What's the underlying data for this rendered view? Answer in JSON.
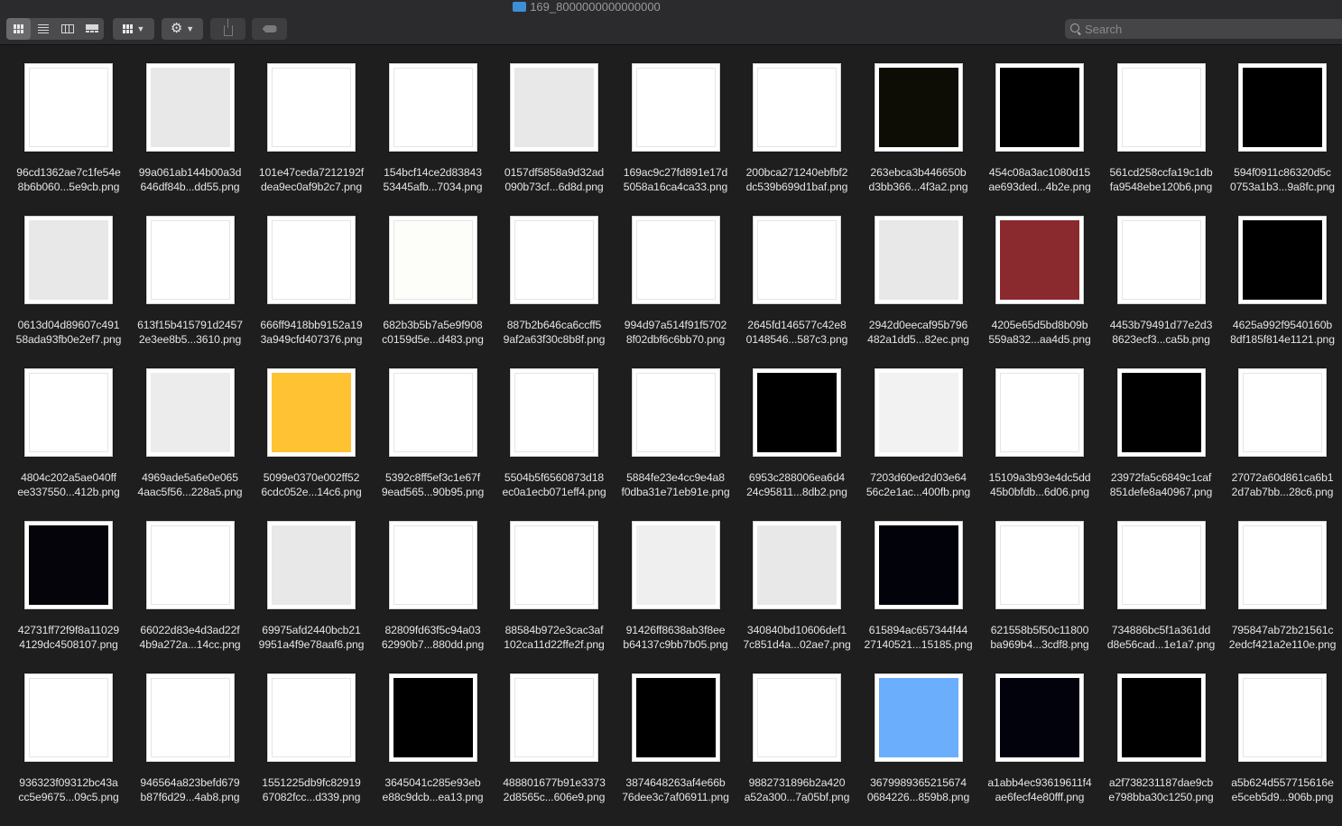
{
  "window": {
    "title": "169_8000000000000000"
  },
  "toolbar": {
    "views": [
      "icon-view",
      "list-view",
      "column-view",
      "gallery-view"
    ],
    "group_icon": "group-by-icon",
    "action_icon": "gear-icon",
    "share_icon": "share-icon",
    "tag_icon": "tag-icon"
  },
  "search": {
    "placeholder": "Search",
    "value": ""
  },
  "files": [
    {
      "line1": "96cd1362ae7c1fe54e",
      "line2": "8b6b060...5e9cb.png",
      "color": "#ffffff"
    },
    {
      "line1": "99a061ab144b00a3d",
      "line2": "646df84b...dd55.png",
      "color": "#e8e8e8"
    },
    {
      "line1": "101e47ceda7212192f",
      "line2": "dea9ec0af9b2c7.png",
      "color": "#ffffff"
    },
    {
      "line1": "154bcf14ce2d83843",
      "line2": "53445afb...7034.png",
      "color": "#ffffff"
    },
    {
      "line1": "0157df5858a9d32ad",
      "line2": "090b73cf...6d8d.png",
      "color": "#e8e8e8"
    },
    {
      "line1": "169ac9c27fd891e17d",
      "line2": "5058a16ca4ca33.png",
      "color": "#ffffff"
    },
    {
      "line1": "200bca271240ebfbf2",
      "line2": "dc539b699d1baf.png",
      "color": "#ffffff"
    },
    {
      "line1": "263ebca3b446650b",
      "line2": "d3bb366...4f3a2.png",
      "color": "#0d0c05"
    },
    {
      "line1": "454c08a3ac1080d15",
      "line2": "ae693ded...4b2e.png",
      "color": "#000000"
    },
    {
      "line1": "561cd258ccfa19c1db",
      "line2": "fa9548ebe120b6.png",
      "color": "#ffffff"
    },
    {
      "line1": "594f0911c86320d5c",
      "line2": "0753a1b3...9a8fc.png",
      "color": "#000000"
    },
    {
      "line1": "0613d04d89607c491",
      "line2": "58ada93fb0e2ef7.png",
      "color": "#e8e8e8"
    },
    {
      "line1": "613f15b415791d2457",
      "line2": "2e3ee8b5...3610.png",
      "color": "#ffffff"
    },
    {
      "line1": "666ff9418bb9152a19",
      "line2": "3a949cfd407376.png",
      "color": "#ffffff"
    },
    {
      "line1": "682b3b5b7a5e9f908",
      "line2": "c0159d5e...d483.png",
      "color": "#fdfdf9"
    },
    {
      "line1": "887b2b646ca6ccff5",
      "line2": "9af2a63f30c8b8f.png",
      "color": "#ffffff"
    },
    {
      "line1": "994d97a514f91f5702",
      "line2": "8f02dbf6c6bb70.png",
      "color": "#ffffff"
    },
    {
      "line1": "2645fd146577c42e8",
      "line2": "0148546...587c3.png",
      "color": "#ffffff"
    },
    {
      "line1": "2942d0eecaf95b796",
      "line2": "482a1dd5...82ec.png",
      "color": "#e8e8e8"
    },
    {
      "line1": "4205e65d5bd8b09b",
      "line2": "559a832...aa4d5.png",
      "color": "#8b2a2e"
    },
    {
      "line1": "4453b79491d77e2d3",
      "line2": "8623ecf3...ca5b.png",
      "color": "#ffffff"
    },
    {
      "line1": "4625a992f9540160b",
      "line2": "8df185f814e1121.png",
      "color": "#000000"
    },
    {
      "line1": "4804c202a5ae040ff",
      "line2": "ee337550...412b.png",
      "color": "#ffffff"
    },
    {
      "line1": "4969ade5a6e0e065",
      "line2": "4aac5f56...228a5.png",
      "color": "#ececec"
    },
    {
      "line1": "5099e0370e002ff52",
      "line2": "6cdc052e...14c6.png",
      "color": "#ffc233"
    },
    {
      "line1": "5392c8ff5ef3c1e67f",
      "line2": "9ead565...90b95.png",
      "color": "#ffffff"
    },
    {
      "line1": "5504b5f6560873d18",
      "line2": "ec0a1ecb071eff4.png",
      "color": "#ffffff"
    },
    {
      "line1": "5884fe23e4cc9e4a8",
      "line2": "f0dba31e71eb91e.png",
      "color": "#ffffff"
    },
    {
      "line1": "6953c288006ea6d4",
      "line2": "24c95811...8db2.png",
      "color": "#000000"
    },
    {
      "line1": "7203d60ed2d03e64",
      "line2": "56c2e1ac...400fb.png",
      "color": "#f2f2f2"
    },
    {
      "line1": "15109a3b93e4dc5dd",
      "line2": "45b0bfdb...6d06.png",
      "color": "#ffffff"
    },
    {
      "line1": "23972fa5c6849c1caf",
      "line2": "851defe8a40967.png",
      "color": "#000000"
    },
    {
      "line1": "27072a60d861ca6b1",
      "line2": "2d7ab7bb...28c6.png",
      "color": "#ffffff"
    },
    {
      "line1": "42731ff72f9f8a11029",
      "line2": "4129dc4508107.png",
      "color": "#05040a"
    },
    {
      "line1": "66022d83e4d3ad22f",
      "line2": "4b9a272a...14cc.png",
      "color": "#ffffff"
    },
    {
      "line1": "69975afd2440bcb21",
      "line2": "9951a4f9e78aaf6.png",
      "color": "#e8e8e8"
    },
    {
      "line1": "82809fd63f5c94a03",
      "line2": "62990b7...880dd.png",
      "color": "#ffffff"
    },
    {
      "line1": "88584b972e3cac3af",
      "line2": "102ca11d22ffe2f.png",
      "color": "#ffffff"
    },
    {
      "line1": "91426ff8638ab3f8ee",
      "line2": "b64137c9bb7b05.png",
      "color": "#efefef"
    },
    {
      "line1": "340840bd10606def1",
      "line2": "7c851d4a...02ae7.png",
      "color": "#e8e8e8"
    },
    {
      "line1": "615894ac657344f44",
      "line2": "27140521...15185.png",
      "color": "#02030a"
    },
    {
      "line1": "621558b5f50c11800",
      "line2": "ba969b4...3cdf8.png",
      "color": "#ffffff"
    },
    {
      "line1": "734886bc5f1a361dd",
      "line2": "d8e56cad...1e1a7.png",
      "color": "#ffffff"
    },
    {
      "line1": "795847ab72b21561c",
      "line2": "2edcf421a2e110e.png",
      "color": "#ffffff"
    },
    {
      "line1": "936323f09312bc43a",
      "line2": "cc5e9675...09c5.png",
      "color": "#ffffff"
    },
    {
      "line1": "946564a823befd679",
      "line2": "b87f6d29...4ab8.png",
      "color": "#ffffff"
    },
    {
      "line1": "1551225db9fc82919",
      "line2": "67082fcc...d339.png",
      "color": "#ffffff"
    },
    {
      "line1": "3645041c285e93eb",
      "line2": "e88c9dcb...ea13.png",
      "color": "#000000"
    },
    {
      "line1": "488801677b91e3373",
      "line2": "2d8565c...606e9.png",
      "color": "#ffffff"
    },
    {
      "line1": "3874648263af4e66b",
      "line2": "76dee3c7af06911.png",
      "color": "#000000"
    },
    {
      "line1": "9882731896b2a420",
      "line2": "a52a300...7a05bf.png",
      "color": "#ffffff"
    },
    {
      "line1": "3679989365215674",
      "line2": "0684226...859b8.png",
      "color": "#6aaefc"
    },
    {
      "line1": "a1abb4ec93619611f4",
      "line2": "ae6fecf4e80fff.png",
      "color": "#02020d"
    },
    {
      "line1": "a2f738231187dae9cb",
      "line2": "e798bba30c1250.png",
      "color": "#000000"
    },
    {
      "line1": "a5b624d557715616e",
      "line2": "e5ceb5d9...906b.png",
      "color": "#ffffff"
    }
  ]
}
